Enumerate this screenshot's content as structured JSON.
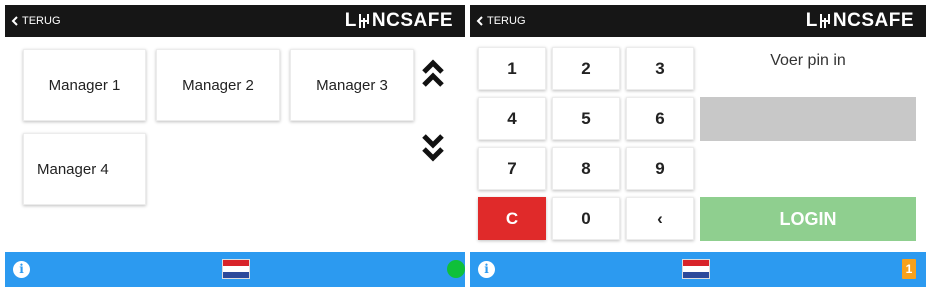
{
  "left_screen": {
    "header": {
      "back_label": "TERUG",
      "logo_text_left": "L",
      "logo_text_right": "NCSAFE"
    },
    "managers": [
      "Manager 1",
      "Manager 2",
      "Manager 3",
      "Manager 4"
    ],
    "scroll_up_icon": "double-chevron-up",
    "scroll_down_icon": "double-chevron-down",
    "footer": {
      "info_icon": "info",
      "info_symbol": "i",
      "language": "nl-flag",
      "status": "online"
    }
  },
  "right_screen": {
    "header": {
      "back_label": "TERUG",
      "logo_text_left": "L",
      "logo_text_right": "NCSAFE"
    },
    "keypad": {
      "row1": [
        "1",
        "2",
        "3"
      ],
      "row2": [
        "4",
        "5",
        "6"
      ],
      "row3": [
        "7",
        "8",
        "9"
      ],
      "clear_label": "C",
      "zero_label": "0",
      "backspace_label": "‹"
    },
    "pin_prompt": "Voer pin in",
    "pin_value": "",
    "login_label": "LOGIN",
    "footer": {
      "info_icon": "info",
      "info_symbol": "i",
      "language": "nl-flag",
      "badge_count": "1"
    }
  },
  "colors": {
    "header": "#161616",
    "footer": "#2c9af0",
    "clear_key": "#e02a2a",
    "login_button": "#8fcf8f",
    "pin_field": "#c8c8c8",
    "status_online": "#0fc03a",
    "badge": "#f7a11c"
  }
}
